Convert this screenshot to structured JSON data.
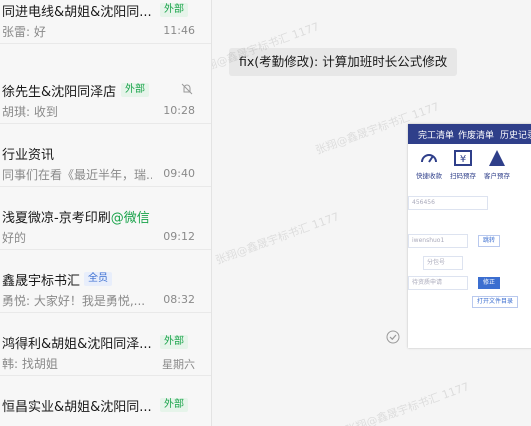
{
  "chat_list": [
    {
      "name": "同进电线&胡姐&沈阳同...",
      "tag": "外部",
      "tag_type": "ext",
      "preview": "张雷: 好",
      "time": "11:46"
    },
    {
      "name": "徐先生&沈阳同泽店",
      "tag": "外部",
      "tag_type": "ext",
      "preview": "胡琪: 收到",
      "time": "10:28",
      "muted": true
    },
    {
      "name": "行业资讯",
      "tag": "",
      "preview": "同事们在看《最近半年，瑞...",
      "time": "09:40"
    },
    {
      "name": "浅夏微凉-京考印刷",
      "suffix": "@微信",
      "tag": "",
      "preview": "好的",
      "time": "09:12"
    },
    {
      "name": "鑫晟宇标书汇",
      "tag": "全员",
      "tag_type": "all",
      "preview": "勇悦: 大家好！我是勇悦,...",
      "time": "08:32"
    },
    {
      "name": "鸿得利&胡姐&沈阳同泽...",
      "tag": "外部",
      "tag_type": "ext",
      "preview": "韩: 找胡姐",
      "time": "星期六"
    },
    {
      "name": "恒昌实业&胡姐&沈阳同...",
      "tag": "外部",
      "tag_type": "ext",
      "preview": "",
      "time": ""
    }
  ],
  "message": {
    "text": "fix(考勤修改): 计算加班时长公式修改"
  },
  "watermark": "张翔@鑫晟宇标书汇 1177",
  "screenshot": {
    "menu": [
      "完工清单",
      "作废清单",
      "历史记录"
    ],
    "tools": [
      "快捷收款",
      "扫码预存",
      "客户预存"
    ],
    "fields": [
      "456456",
      "iwenshuo1",
      "分包号",
      "待资质申请"
    ],
    "buttons": [
      "跳转",
      "修正",
      "打开文件目录"
    ]
  },
  "colors": {
    "external_tag": "#19a34a",
    "all_tag": "#3b6ed0",
    "app_topbar": "#2f3f8a"
  }
}
